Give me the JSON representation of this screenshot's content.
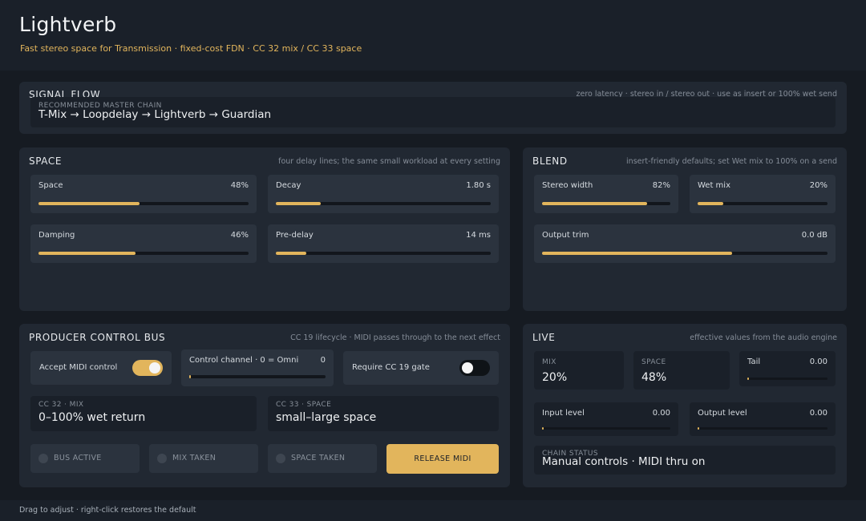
{
  "app": {
    "title": "Lightverb",
    "subtitle": "Fast stereo space for Transmission · fixed-cost FDN · CC 32 mix / CC 33 space"
  },
  "colors": {
    "accent": "#e2b55c",
    "background": "#161b22",
    "card": "#212832"
  },
  "signal_flow": {
    "title": "SIGNAL FLOW",
    "note": "zero latency · stereo in / stereo out · use as insert or 100% wet send",
    "chain_caption": "RECOMMENDED MASTER CHAIN",
    "chain": "T-Mix  →  Loopdelay  →  Lightverb  →  Guardian"
  },
  "space": {
    "title": "SPACE",
    "note": "four delay lines; the same small workload at every setting",
    "params": [
      {
        "label": "Space",
        "value": "48%",
        "level": 0.48
      },
      {
        "label": "Decay",
        "value": "1.80 s",
        "level": 0.21
      },
      {
        "label": "Damping",
        "value": "46%",
        "level": 0.46
      },
      {
        "label": "Pre-delay",
        "value": "14 ms",
        "level": 0.14
      }
    ]
  },
  "blend": {
    "title": "BLEND",
    "note": "insert-friendly defaults; set Wet mix to 100% on a send",
    "params": [
      {
        "label": "Stereo width",
        "value": "82%",
        "level": 0.82
      },
      {
        "label": "Wet mix",
        "value": "20%",
        "level": 0.2
      },
      {
        "label": "Output trim",
        "value": "0.0 dB",
        "level": 0.665
      }
    ]
  },
  "bus": {
    "title": "PRODUCER CONTROL BUS",
    "note": "CC 19 lifecycle · MIDI passes through to the next effect",
    "accept_label": "Accept MIDI control",
    "accept_on": true,
    "channel_label": "Control channel · 0 = Omni",
    "channel_value": "0",
    "channel_level": 0,
    "gate_label": "Require CC 19 gate",
    "gate_on": false,
    "cc32_caption": "CC 32 · MIX",
    "cc32_value": "0–100% wet return",
    "cc33_caption": "CC 33 · SPACE",
    "cc33_value": "small–large space",
    "status": [
      "BUS ACTIVE",
      "MIX TAKEN",
      "SPACE TAKEN"
    ],
    "release_label": "RELEASE MIDI"
  },
  "live": {
    "title": "LIVE",
    "note": "effective values from the audio engine",
    "mix_caption": "MIX",
    "mix_value": "20%",
    "space_caption": "SPACE",
    "space_value": "48%",
    "tail_label": "Tail",
    "tail_value": "0.00",
    "tail_level": 0,
    "input_label": "Input level",
    "input_value": "0.00",
    "input_level": 0,
    "output_label": "Output level",
    "output_value": "0.00",
    "output_level": 0,
    "chain_status_caption": "CHAIN STATUS",
    "chain_status_value": "Manual controls · MIDI thru on"
  },
  "footer": {
    "hint": "Drag to adjust · right-click restores the default"
  }
}
